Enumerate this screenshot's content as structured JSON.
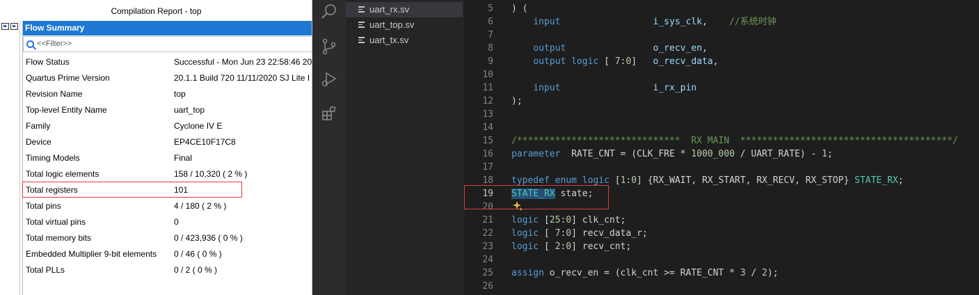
{
  "quartus": {
    "window_title": "Compilation Report - top",
    "panel_header": "Flow Summary",
    "filter_placeholder": "<<Filter>>",
    "rows": [
      {
        "key": "Flow Status",
        "value": "Successful - Mon Jun 23 22:58:46 20"
      },
      {
        "key": "Quartus Prime Version",
        "value": "20.1.1 Build 720 11/11/2020 SJ Lite I"
      },
      {
        "key": "Revision Name",
        "value": "top"
      },
      {
        "key": "Top-level Entity Name",
        "value": "uart_top"
      },
      {
        "key": "Family",
        "value": "Cyclone IV E"
      },
      {
        "key": "Device",
        "value": "EP4CE10F17C8"
      },
      {
        "key": "Timing Models",
        "value": "Final"
      },
      {
        "key": "Total logic elements",
        "value": "158 / 10,320 ( 2 % )"
      },
      {
        "key": "Total registers",
        "value": "101"
      },
      {
        "key": "Total pins",
        "value": "4 / 180 ( 2 % )"
      },
      {
        "key": "Total virtual pins",
        "value": "0"
      },
      {
        "key": "Total memory bits",
        "value": "0 / 423,936 ( 0 % )"
      },
      {
        "key": "Embedded Multiplier 9-bit elements",
        "value": "0 / 46 ( 0 % )"
      },
      {
        "key": "Total PLLs",
        "value": "0 / 2 ( 0 % )"
      }
    ],
    "highlight_color": "#e0393e"
  },
  "vscode": {
    "activity_icons": [
      "search-icon",
      "source-control-icon",
      "run-debug-icon",
      "extensions-icon"
    ],
    "files": [
      {
        "name": "uart_rx.sv",
        "active": true
      },
      {
        "name": "uart_top.sv",
        "active": false
      },
      {
        "name": "uart_tx.sv",
        "active": false
      }
    ],
    "current_line": 19,
    "lines": [
      {
        "n": "5",
        "tokens": [
          {
            "c": "pl",
            "t": ") ("
          }
        ]
      },
      {
        "n": "6",
        "tokens": [
          {
            "c": "pl",
            "t": "    "
          },
          {
            "c": "kw",
            "t": "input"
          },
          {
            "c": "pl",
            "t": "                 "
          },
          {
            "c": "id",
            "t": "i_sys_clk"
          },
          {
            "c": "pl",
            "t": ",    "
          },
          {
            "c": "cm",
            "t": "//系统时钟"
          }
        ]
      },
      {
        "n": "7",
        "tokens": []
      },
      {
        "n": "8",
        "tokens": [
          {
            "c": "pl",
            "t": "    "
          },
          {
            "c": "kw",
            "t": "output"
          },
          {
            "c": "pl",
            "t": "                "
          },
          {
            "c": "id",
            "t": "o_recv_en"
          },
          {
            "c": "pl",
            "t": ","
          }
        ]
      },
      {
        "n": "9",
        "tokens": [
          {
            "c": "pl",
            "t": "    "
          },
          {
            "c": "kw",
            "t": "output"
          },
          {
            "c": "pl",
            "t": " "
          },
          {
            "c": "kw",
            "t": "logic"
          },
          {
            "c": "pl",
            "t": " [ "
          },
          {
            "c": "nm",
            "t": "7"
          },
          {
            "c": "pl",
            "t": ":"
          },
          {
            "c": "nm",
            "t": "0"
          },
          {
            "c": "pl",
            "t": "]   "
          },
          {
            "c": "id",
            "t": "o_recv_data"
          },
          {
            "c": "pl",
            "t": ","
          }
        ]
      },
      {
        "n": "10",
        "tokens": []
      },
      {
        "n": "11",
        "tokens": [
          {
            "c": "pl",
            "t": "    "
          },
          {
            "c": "kw",
            "t": "input"
          },
          {
            "c": "pl",
            "t": "                 "
          },
          {
            "c": "id",
            "t": "i_rx_pin"
          }
        ]
      },
      {
        "n": "12",
        "tokens": [
          {
            "c": "pl",
            "t": ");"
          }
        ]
      },
      {
        "n": "13",
        "tokens": []
      },
      {
        "n": "14",
        "tokens": []
      },
      {
        "n": "15",
        "tokens": [
          {
            "c": "cm",
            "t": "/******************************  RX MAIN  ***************************************/"
          }
        ]
      },
      {
        "n": "16",
        "tokens": [
          {
            "c": "kw",
            "t": "parameter"
          },
          {
            "c": "pl",
            "t": "  RATE_CNT = (CLK_FRE * "
          },
          {
            "c": "nm",
            "t": "1000_000"
          },
          {
            "c": "pl",
            "t": " / UART_RATE) - "
          },
          {
            "c": "nm",
            "t": "1"
          },
          {
            "c": "pl",
            "t": ";"
          }
        ]
      },
      {
        "n": "17",
        "tokens": []
      },
      {
        "n": "18",
        "tokens": [
          {
            "c": "kw",
            "t": "typedef"
          },
          {
            "c": "pl",
            "t": " "
          },
          {
            "c": "kw",
            "t": "enum"
          },
          {
            "c": "pl",
            "t": " "
          },
          {
            "c": "kw",
            "t": "logic"
          },
          {
            "c": "pl",
            "t": " ["
          },
          {
            "c": "nm",
            "t": "1"
          },
          {
            "c": "pl",
            "t": ":"
          },
          {
            "c": "nm",
            "t": "0"
          },
          {
            "c": "pl",
            "t": "] {RX_WAIT, RX_START, RX_RECV, RX_STOP} "
          },
          {
            "c": "ty",
            "t": "STATE_RX"
          },
          {
            "c": "pl",
            "t": ";"
          }
        ]
      },
      {
        "n": "19",
        "tokens": [
          {
            "c": "ty sel",
            "t": "STATE_RX"
          },
          {
            "c": "pl",
            "t": " state;"
          }
        ]
      },
      {
        "n": "20",
        "tokens": []
      },
      {
        "n": "21",
        "tokens": [
          {
            "c": "kw",
            "t": "logic"
          },
          {
            "c": "pl",
            "t": " ["
          },
          {
            "c": "nm",
            "t": "25"
          },
          {
            "c": "pl",
            "t": ":"
          },
          {
            "c": "nm",
            "t": "0"
          },
          {
            "c": "pl",
            "t": "] clk_cnt;"
          }
        ]
      },
      {
        "n": "22",
        "tokens": [
          {
            "c": "kw",
            "t": "logic"
          },
          {
            "c": "pl",
            "t": " [ "
          },
          {
            "c": "nm",
            "t": "7"
          },
          {
            "c": "pl",
            "t": ":"
          },
          {
            "c": "nm",
            "t": "0"
          },
          {
            "c": "pl",
            "t": "] recv_data_r;"
          }
        ]
      },
      {
        "n": "23",
        "tokens": [
          {
            "c": "kw",
            "t": "logic"
          },
          {
            "c": "pl",
            "t": " [ "
          },
          {
            "c": "nm",
            "t": "2"
          },
          {
            "c": "pl",
            "t": ":"
          },
          {
            "c": "nm",
            "t": "0"
          },
          {
            "c": "pl",
            "t": "] recv_cnt;"
          }
        ]
      },
      {
        "n": "24",
        "tokens": []
      },
      {
        "n": "25",
        "tokens": [
          {
            "c": "kw",
            "t": "assign"
          },
          {
            "c": "pl",
            "t": " o_recv_en = (clk_cnt >= RATE_CNT * "
          },
          {
            "c": "nm",
            "t": "3"
          },
          {
            "c": "pl",
            "t": " / "
          },
          {
            "c": "nm",
            "t": "2"
          },
          {
            "c": "pl",
            "t": ");"
          }
        ]
      },
      {
        "n": "26",
        "tokens": []
      }
    ]
  }
}
